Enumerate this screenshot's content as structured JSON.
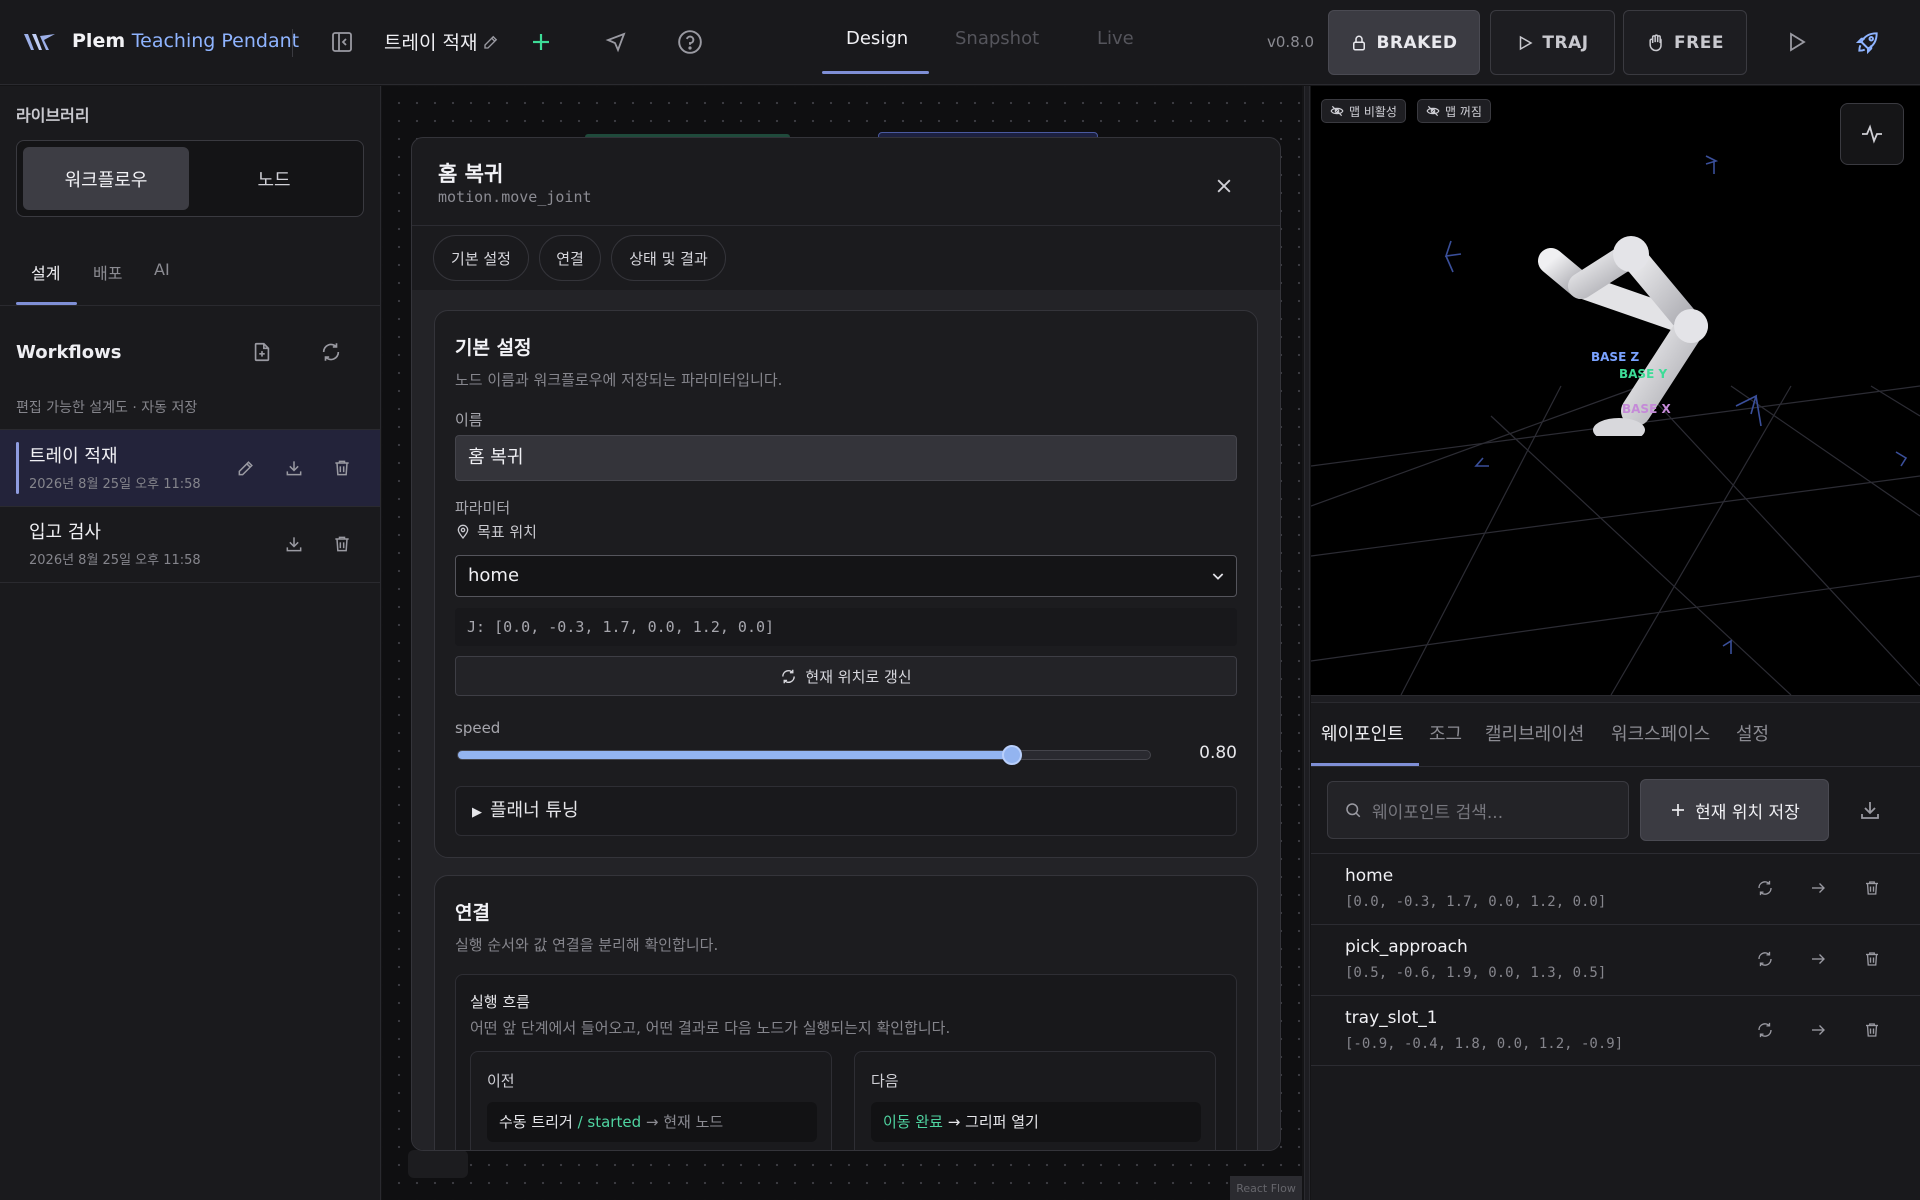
{
  "topbar": {
    "brand_main": "Plem",
    "brand_sub": "Teaching Pendant",
    "workflow_title": "트레이 적재",
    "mode_tabs": [
      "Design",
      "Snapshot",
      "Live"
    ],
    "active_mode": "Design",
    "version": "v0.8.0",
    "state_buttons": [
      {
        "label": "BRAKED",
        "icon": "lock-icon",
        "active": true
      },
      {
        "label": "TRAJ",
        "icon": "play-outline-icon",
        "active": false
      },
      {
        "label": "FREE",
        "icon": "hand-icon",
        "active": false
      }
    ]
  },
  "sidebar": {
    "library_title": "라이브러리",
    "segments": [
      "워크플로우",
      "노드"
    ],
    "active_segment": "워크플로우",
    "subtabs": [
      "설계",
      "배포",
      "AI"
    ],
    "active_subtab": "설계",
    "workflows_title": "Workflows",
    "workflows_hint": "편집 가능한 설계도 · 자동 저장",
    "workflows": [
      {
        "name": "트레이 적재",
        "date": "2026년 8월 25일 오후 11:58",
        "selected": true
      },
      {
        "name": "입고 검사",
        "date": "2026년 8월 25일 오후 11:58",
        "selected": false
      }
    ]
  },
  "canvas": {
    "attribution": "React Flow"
  },
  "modal": {
    "title": "홈 복귀",
    "subtitle": "motion.move_joint",
    "tabs": [
      "기본 설정",
      "연결",
      "상태 및 결과"
    ],
    "basic": {
      "title": "기본 설정",
      "desc": "노드 이름과 워크플로우에 저장되는 파라미터입니다.",
      "name_label": "이름",
      "name_value": "홈 복귀",
      "params_label": "파라미터",
      "target_label": "목표 위치",
      "target_value": "home",
      "joint_readout": "J: [0.0, -0.3, 1.7, 0.0, 1.2, 0.0]",
      "refresh_label": "현재 위치로 갱신",
      "speed_label": "speed",
      "speed_value": 0.8,
      "speed_text": "0.80",
      "planner_label": "플래너 튜닝"
    },
    "connection": {
      "title": "연결",
      "desc": "실행 순서와 값 연결을 분리해 확인합니다.",
      "flow_title": "실행 흐름",
      "flow_desc": "어떤 앞 단계에서 들어오고, 어떤 결과로 다음 노드가 실행되는지 확인합니다.",
      "prev_label": "이전",
      "prev_source": "수동 트리거",
      "prev_slash": "/",
      "prev_event": "started",
      "prev_arrow": "→ 현재 노드",
      "next_label": "다음",
      "next_event": "이동 완료",
      "next_arrow": "→ 그리퍼 열기"
    }
  },
  "viewer": {
    "chips": [
      "맵 비활성",
      "맵 꺼짐"
    ],
    "axis_labels": [
      "BASE Z",
      "BASE Y",
      "BASE X"
    ],
    "colors": {
      "z": "#7aa2ff",
      "y": "#3ddc97",
      "x": "#c58ad8"
    }
  },
  "waypoints": {
    "tabs": [
      "웨이포인트",
      "조그",
      "캘리브레이션",
      "워크스페이스",
      "설정"
    ],
    "active_tab": "웨이포인트",
    "search_placeholder": "웨이포인트 검색...",
    "save_label": "현재 위치 저장",
    "items": [
      {
        "name": "home",
        "coords": "[0.0, -0.3, 1.7, 0.0, 1.2, 0.0]"
      },
      {
        "name": "pick_approach",
        "coords": "[0.5, -0.6, 1.9, 0.0, 1.3, 0.5]"
      },
      {
        "name": "tray_slot_1",
        "coords": "[-0.9, -0.4, 1.8, 0.0, 1.2, -0.9]"
      }
    ]
  }
}
